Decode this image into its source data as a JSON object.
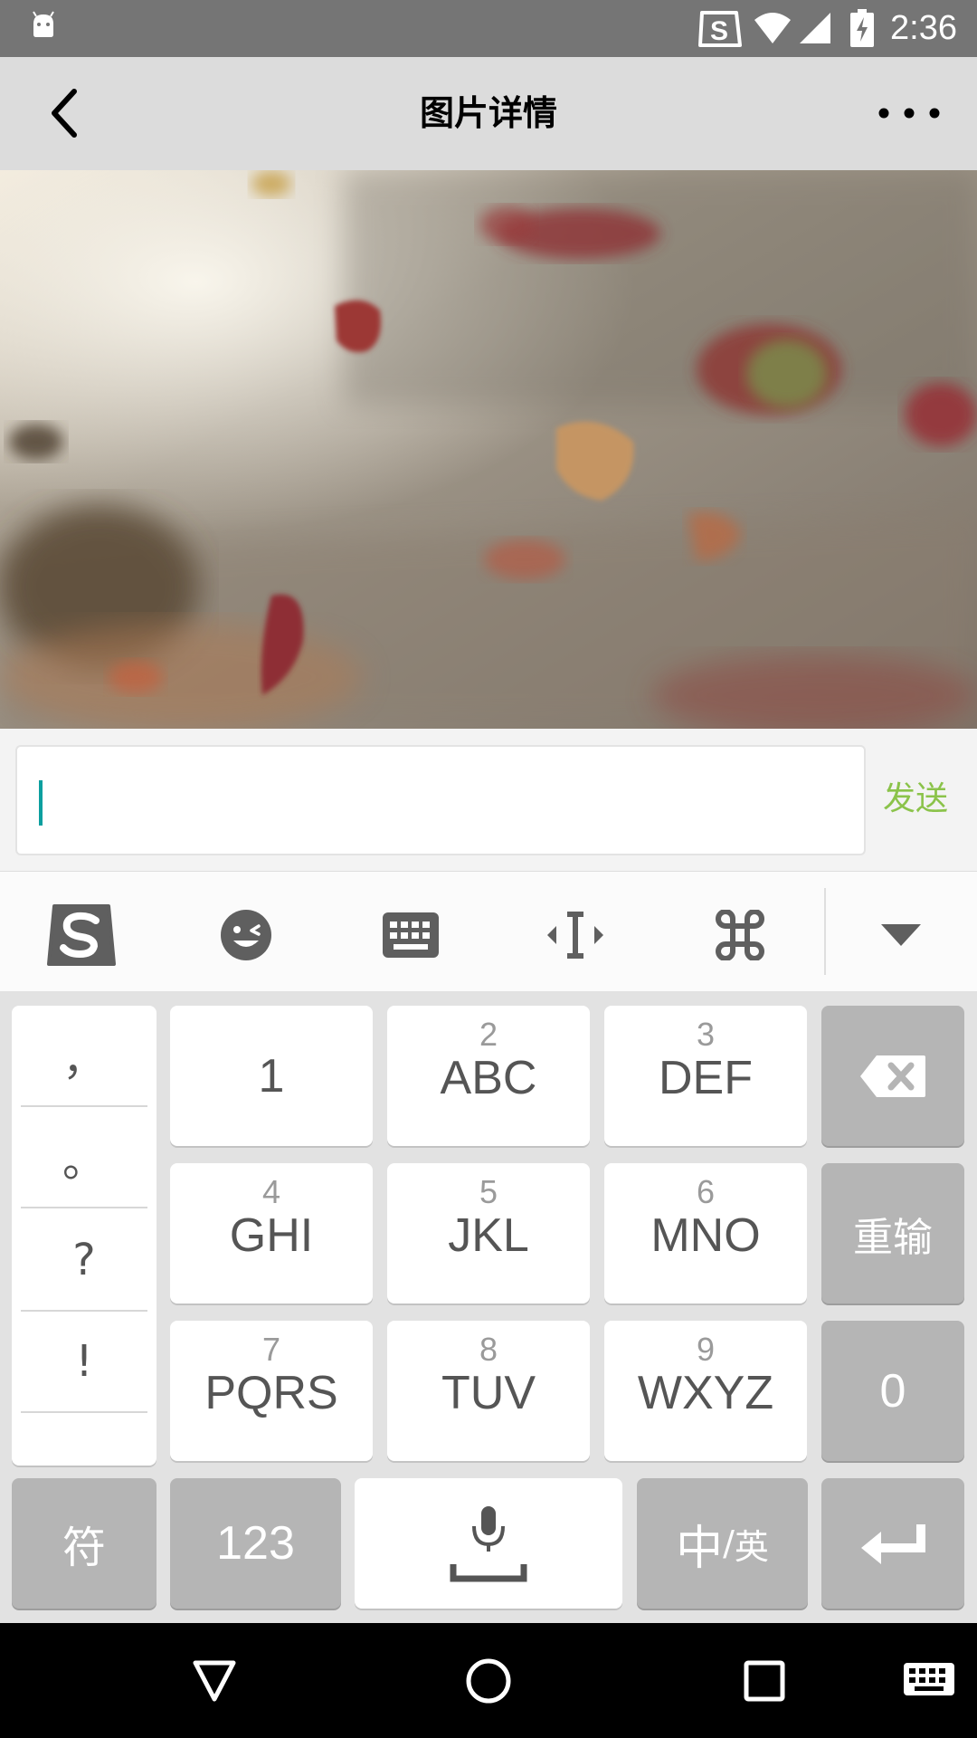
{
  "status_bar": {
    "time": "2:36",
    "icons": [
      "android-icon",
      "sogou-status-icon",
      "wifi-icon",
      "signal-icon",
      "battery-charging-icon"
    ]
  },
  "title_bar": {
    "title": "图片详情",
    "back_icon": "chevron-left-icon",
    "more_icon": "more-horizontal-icon"
  },
  "photo": {
    "description_icon": "image"
  },
  "comment": {
    "input_value": "",
    "send_label": "发送"
  },
  "ime_toolbar": {
    "tools": [
      "sogou-logo-icon",
      "emoji-icon",
      "keyboard-icon",
      "cursor-move-icon",
      "command-icon",
      "collapse-keyboard-icon"
    ]
  },
  "keyboard": {
    "punctuation": [
      "，",
      "。",
      "?",
      "!"
    ],
    "keys": [
      {
        "digit": "",
        "letters": "1"
      },
      {
        "digit": "2",
        "letters": "ABC"
      },
      {
        "digit": "3",
        "letters": "DEF"
      },
      {
        "digit": "4",
        "letters": "GHI"
      },
      {
        "digit": "5",
        "letters": "JKL"
      },
      {
        "digit": "6",
        "letters": "MNO"
      },
      {
        "digit": "7",
        "letters": "PQRS"
      },
      {
        "digit": "8",
        "letters": "TUV"
      },
      {
        "digit": "9",
        "letters": "WXYZ"
      }
    ],
    "reset_label": "重输",
    "zero_label": "0",
    "symbols_label": "符",
    "numbers_label": "123",
    "lang_zh": "中",
    "lang_sep": "/",
    "lang_en": "英",
    "delete_icon": "backspace-icon",
    "space_icons": [
      "microphone-icon",
      "space-bar-icon"
    ],
    "enter_icon": "enter-icon"
  },
  "nav_bar": {
    "icons": [
      "back-triangle-icon",
      "home-circle-icon",
      "recents-square-icon",
      "keyboard-switch-icon"
    ]
  },
  "colors": {
    "status_bar": "#757575",
    "title_bar": "#dcdcdc",
    "send_accent": "#8bc34a",
    "cursor": "#0b9f9f",
    "gray_key": "#b5b5b5"
  }
}
